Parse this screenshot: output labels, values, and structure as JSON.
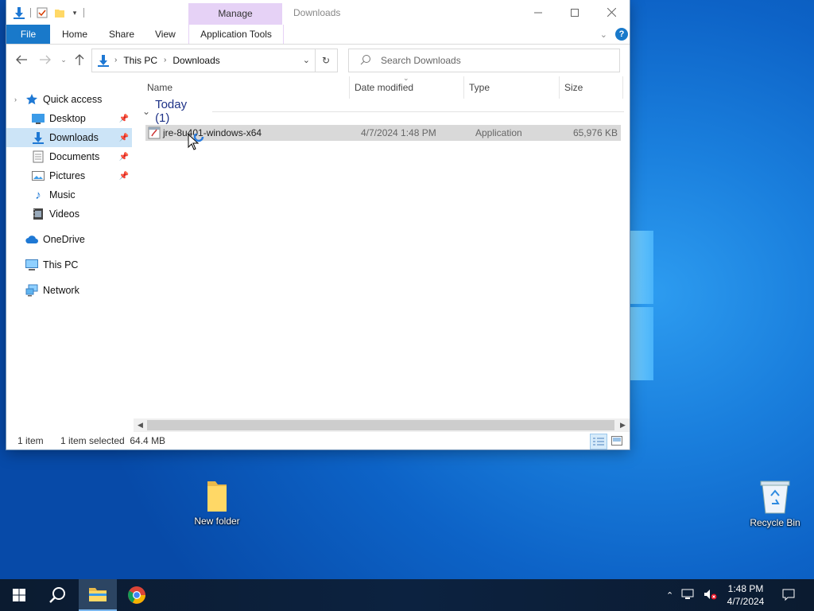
{
  "window": {
    "title": "Downloads",
    "context_tab": "Manage",
    "tabs": [
      "File",
      "Home",
      "Share",
      "View",
      "Application Tools"
    ]
  },
  "navigation": {
    "breadcrumb": [
      "This PC",
      "Downloads"
    ],
    "search_placeholder": "Search Downloads"
  },
  "sidebar": {
    "quick_access": "Quick access",
    "items": [
      {
        "label": "Desktop",
        "pinned": true
      },
      {
        "label": "Downloads",
        "pinned": true,
        "selected": true
      },
      {
        "label": "Documents",
        "pinned": true
      },
      {
        "label": "Pictures",
        "pinned": true
      },
      {
        "label": "Music"
      },
      {
        "label": "Videos"
      }
    ],
    "onedrive": "OneDrive",
    "this_pc": "This PC",
    "network": "Network"
  },
  "files": {
    "columns": [
      "Name",
      "Date modified",
      "Type",
      "Size"
    ],
    "group": "Today (1)",
    "rows": [
      {
        "name": "jre-8u401-windows-x64",
        "date": "4/7/2024 1:48 PM",
        "type": "Application",
        "size": "65,976 KB"
      }
    ]
  },
  "status": {
    "count": "1 item",
    "selection": "1 item selected  64.4 MB"
  },
  "desktop": {
    "icons": [
      {
        "label": "New folder"
      },
      {
        "label": "Recycle Bin"
      }
    ]
  },
  "taskbar": {
    "time": "1:48 PM",
    "date": "4/7/2024"
  },
  "colors": {
    "accent": "#1979ca",
    "context_tab": "#e6d2f6",
    "selection": "#cce4f7",
    "row_selected": "#d9d9d9"
  }
}
